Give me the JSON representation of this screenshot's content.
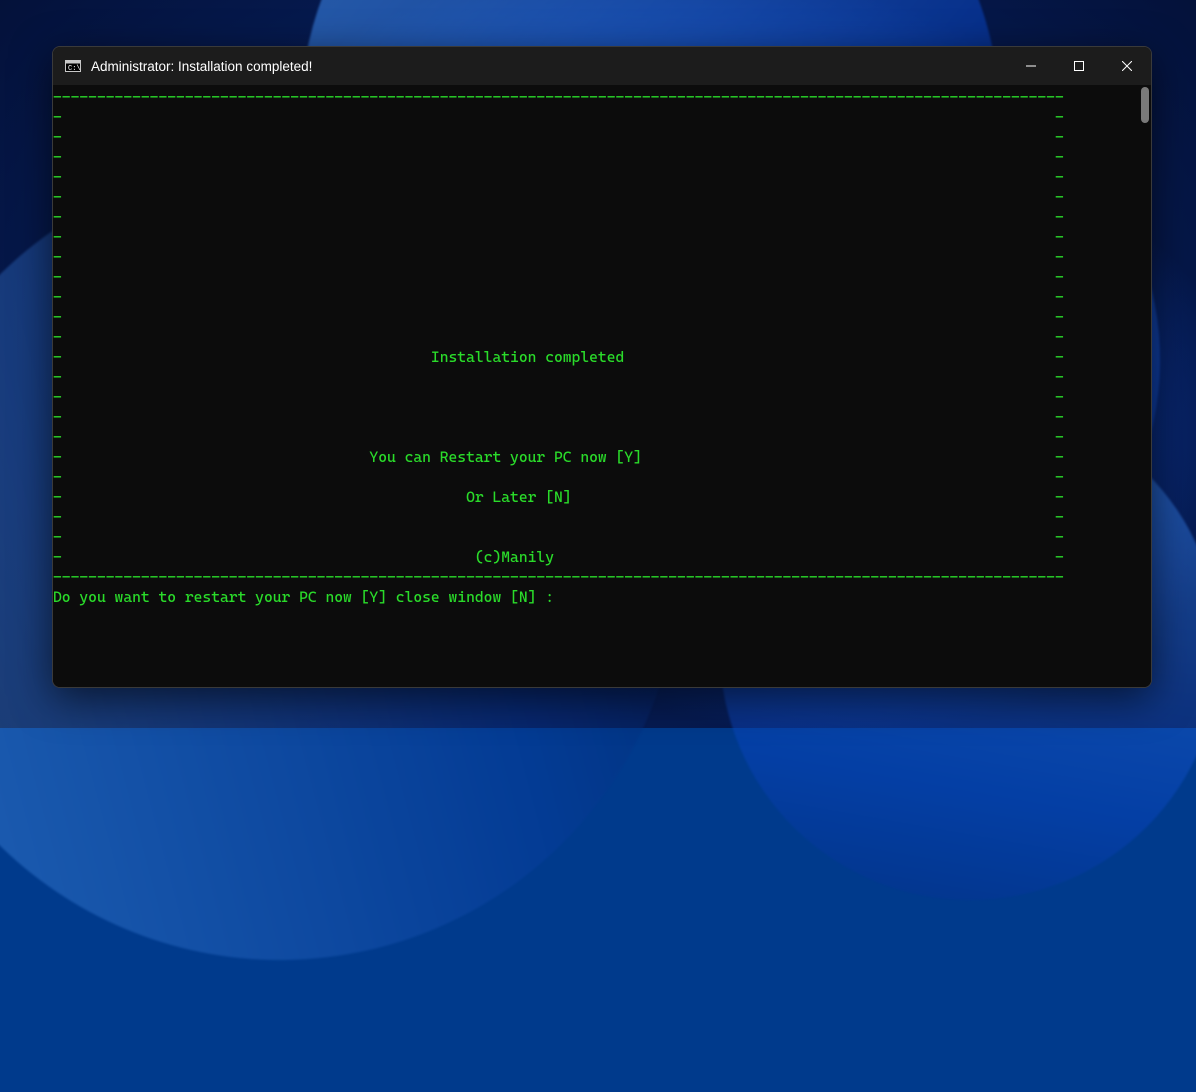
{
  "window": {
    "title": "Administrator:  Installation completed!"
  },
  "console": {
    "box_top": "-------------------------------------------------------------------------------------------------------------------",
    "box_side_left": "-",
    "box_side_right": "-",
    "line_installed": "-                                          Installation completed                                                 -",
    "line_restart": "-                                   You can Restart your PC now [Y]                                               -",
    "line_later": "-                                              Or Later [N]                                                       -",
    "line_credit": "-                                               (c)Manily                                                         -",
    "box_bottom": "-------------------------------------------------------------------------------------------------------------------",
    "prompt": "Do you want to restart your PC now [Y] close window [N] :"
  }
}
